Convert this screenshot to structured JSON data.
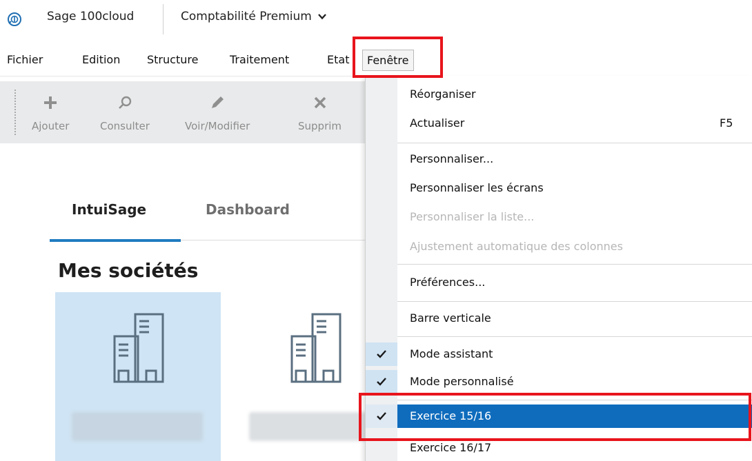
{
  "titlebar": {
    "logo_icon": "sage-compass-icon",
    "app_name": "Sage 100cloud",
    "product": "Comptabilité Premium",
    "chevron_icon": "chevron-down-icon"
  },
  "menubar": {
    "items": [
      "Fichier",
      "Edition",
      "Structure",
      "Traitement",
      "Etat",
      "Fenêtre"
    ],
    "open_item": "Fenêtre"
  },
  "toolbar": {
    "buttons": [
      {
        "label": "Ajouter",
        "icon": "plus-icon"
      },
      {
        "label": "Consulter",
        "icon": "search-icon"
      },
      {
        "label": "Voir/Modifier",
        "icon": "pencil-icon"
      },
      {
        "label": "Supprim",
        "icon": "close-icon"
      }
    ]
  },
  "tabs": [
    {
      "label": "IntuiSage",
      "active": true
    },
    {
      "label": "Dashboard",
      "active": false
    }
  ],
  "section": {
    "title": "Mes sociétés"
  },
  "companies": [
    {
      "icon": "building-icon",
      "selected": true
    },
    {
      "icon": "building-icon",
      "selected": false
    }
  ],
  "dropdown": {
    "items": [
      {
        "label": "Réorganiser"
      },
      {
        "label": "Actualiser",
        "shortcut": "F5"
      },
      {
        "label": "Personnaliser..."
      },
      {
        "label": "Personnaliser les écrans"
      },
      {
        "label": "Personnaliser la liste...",
        "disabled": true
      },
      {
        "label": "Ajustement automatique des colonnes",
        "disabled": true
      },
      {
        "label": "Préférences..."
      },
      {
        "label": "Barre verticale"
      },
      {
        "label": "Mode assistant",
        "checked": true
      },
      {
        "label": "Mode personnalisé",
        "checked": true
      },
      {
        "label": "Exercice 15/16",
        "checked": true,
        "selected": true
      },
      {
        "label": "Exercice 16/17"
      }
    ]
  },
  "colors": {
    "accent": "#1f7bc0",
    "selection": "#0f6cbd",
    "highlight": "#e8141c",
    "tile_selected": "#cfe4f4"
  }
}
